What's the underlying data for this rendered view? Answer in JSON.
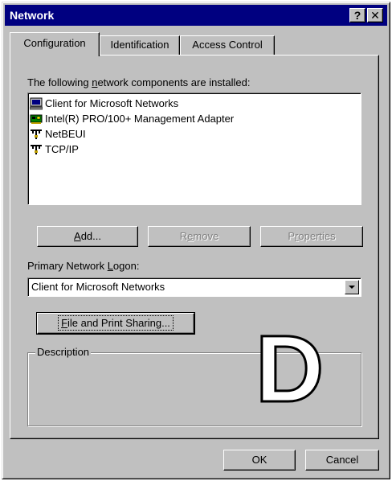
{
  "window": {
    "title": "Network",
    "help_label": "?",
    "close_label": "✕"
  },
  "tabs": [
    {
      "label": "Configuration",
      "active": true
    },
    {
      "label": "Identification",
      "active": false
    },
    {
      "label": "Access Control",
      "active": false
    }
  ],
  "components": {
    "label_pre": "The following ",
    "label_mnemonic": "n",
    "label_post": "etwork components are installed:",
    "items": [
      {
        "label": "Client for Microsoft Networks",
        "icon": "network-client-icon"
      },
      {
        "label": "Intel(R) PRO/100+ Management Adapter",
        "icon": "network-adapter-icon"
      },
      {
        "label": "NetBEUI",
        "icon": "protocol-icon"
      },
      {
        "label": "TCP/IP",
        "icon": "protocol-icon"
      }
    ]
  },
  "buttons": {
    "add": {
      "mn": "A",
      "rest": "dd..."
    },
    "remove": {
      "pre": "R",
      "mn": "e",
      "rest": "move"
    },
    "properties": {
      "pre": "P",
      "mn": "r",
      "rest": "operties"
    }
  },
  "logon": {
    "label_pre": "Primary Network ",
    "label_mnemonic": "L",
    "label_post": "ogon:",
    "value": "Client for Microsoft Networks"
  },
  "file_sharing": {
    "mn": "F",
    "rest": "ile and Print Sharing..."
  },
  "description": {
    "title": "Description"
  },
  "overlay_letter": "D",
  "footer": {
    "ok_label": "OK",
    "cancel_label": "Cancel"
  }
}
